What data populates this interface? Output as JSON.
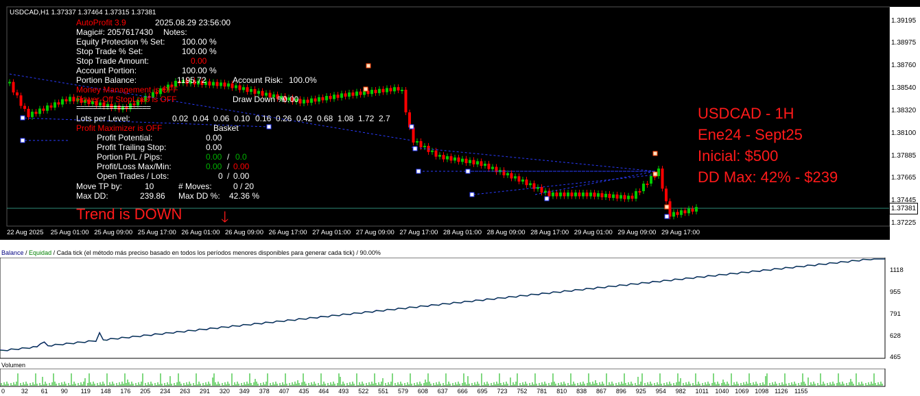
{
  "chart": {
    "symbol_header": "USDCAD,H1  1.37337 1.37464 1.37315 1.37381",
    "price_ticks": [
      "1.39195",
      "1.38975",
      "1.38760",
      "1.38540",
      "1.38320",
      "1.38100",
      "1.37885",
      "1.37665",
      "1.37445",
      "1.37225"
    ],
    "current_price": "1.37381",
    "time_ticks": [
      "22 Aug 2025",
      "25 Aug 01:00",
      "25 Aug 09:00",
      "25 Aug 17:00",
      "26 Aug 01:00",
      "26 Aug 09:00",
      "26 Aug 17:00",
      "27 Aug 01:00",
      "27 Aug 09:00",
      "27 Aug 17:00",
      "28 Aug 01:00",
      "28 Aug 09:00",
      "28 Aug 17:00",
      "29 Aug 01:00",
      "29 Aug 09:00",
      "29 Aug 17:00"
    ],
    "colors": {
      "bull": "#00cc00",
      "bear": "#ff0000",
      "background": "#000000",
      "accent": "#ff1a1a"
    }
  },
  "ea_panel": {
    "name": "AutoProfit 3.9",
    "datetime": "2025.08.29 23:56:00",
    "magic_label": "Magic#: 2057617430",
    "notes_label": "Notes:",
    "equity_protection_label": "Equity Protection % Set:",
    "equity_protection_value": "100.00 %",
    "stop_trade_pct_label": "Stop Trade % Set:",
    "stop_trade_pct_value": "100.00 %",
    "stop_trade_amount_label": "Stop Trade Amount:",
    "stop_trade_amount_value": "0.00",
    "account_portion_label": "Account Portion:",
    "account_portion_value": "100.00 %",
    "portion_balance_label": "Portion Balance:",
    "portion_balance_value": "1195.72",
    "account_risk_label": "Account Risk:",
    "account_risk_value": "100.0%",
    "money_management": "Money Management is OFF",
    "poweroff_stoploss": "Power-Off StopLoss is OFF",
    "drawdown_label": "Draw Down %:",
    "drawdown_value": "0.00",
    "separator": "==================",
    "lots_label": "Lots per Level:",
    "lots_values": [
      "0.02",
      "0.04",
      "0.06",
      "0.10",
      "0.16",
      "0.26",
      "0.42",
      "0.68",
      "1.08",
      "1.72",
      "2.7"
    ],
    "profit_maximizer": "Profit Maximizer is OFF",
    "basket_label": "Basket",
    "profit_potential_label": "Profit Potential:",
    "profit_potential_value": "0.00",
    "profit_trailing_label": "Profit Trailing Stop:",
    "profit_trailing_value": "0.00",
    "portion_pl_label": "Portion P/L / Pips:",
    "portion_pl_value": "0.00",
    "portion_pips_value": "0.0",
    "pl_maxmin_label": "Profit/Loss Max/Min:",
    "pl_max_value": "0.00",
    "pl_min_value": "0.00",
    "open_trades_label": "Open Trades / Lots:",
    "open_trades_value": "0",
    "open_lots_value": "0.00",
    "move_tp_label": "Move TP by:",
    "move_tp_value": "10",
    "moves_label": "# Moves:",
    "moves_value": "0 / 20",
    "max_dd_label": "Max DD:",
    "max_dd_value": "239.86",
    "max_dd_pct_label": "Max DD %:",
    "max_dd_pct_value": "42.36 %",
    "slash": "/"
  },
  "overlay": {
    "lines": [
      "USDCAD - 1H",
      "Ene24 - Sept25",
      "Inicial: $500",
      "DD Max: 42% - $239"
    ],
    "trend_label": "Trend is DOWN",
    "trend_arrow": "🡓"
  },
  "report": {
    "balance_label": "Balance",
    "separator": " / ",
    "equity_label": "Equidad",
    "description": " / Cada tick (el método más preciso basado en todos los períodos menores disponibles para generar cada tick)  / 90.00%",
    "balance_ticks": [
      "1118",
      "955",
      "791",
      "628",
      "465"
    ],
    "volume_title": "Volumen",
    "volume_ticks": [
      "0",
      "32",
      "61",
      "90",
      "119",
      "148",
      "176",
      "205",
      "234",
      "263",
      "291",
      "320",
      "349",
      "378",
      "407",
      "435",
      "464",
      "493",
      "522",
      "551",
      "579",
      "608",
      "637",
      "666",
      "695",
      "723",
      "752",
      "781",
      "810",
      "838",
      "867",
      "896",
      "925",
      "954",
      "982",
      "1011",
      "1040",
      "1069",
      "1098",
      "1126",
      "1155"
    ],
    "balance_color": "#000080",
    "equity_color": "#008000"
  }
}
